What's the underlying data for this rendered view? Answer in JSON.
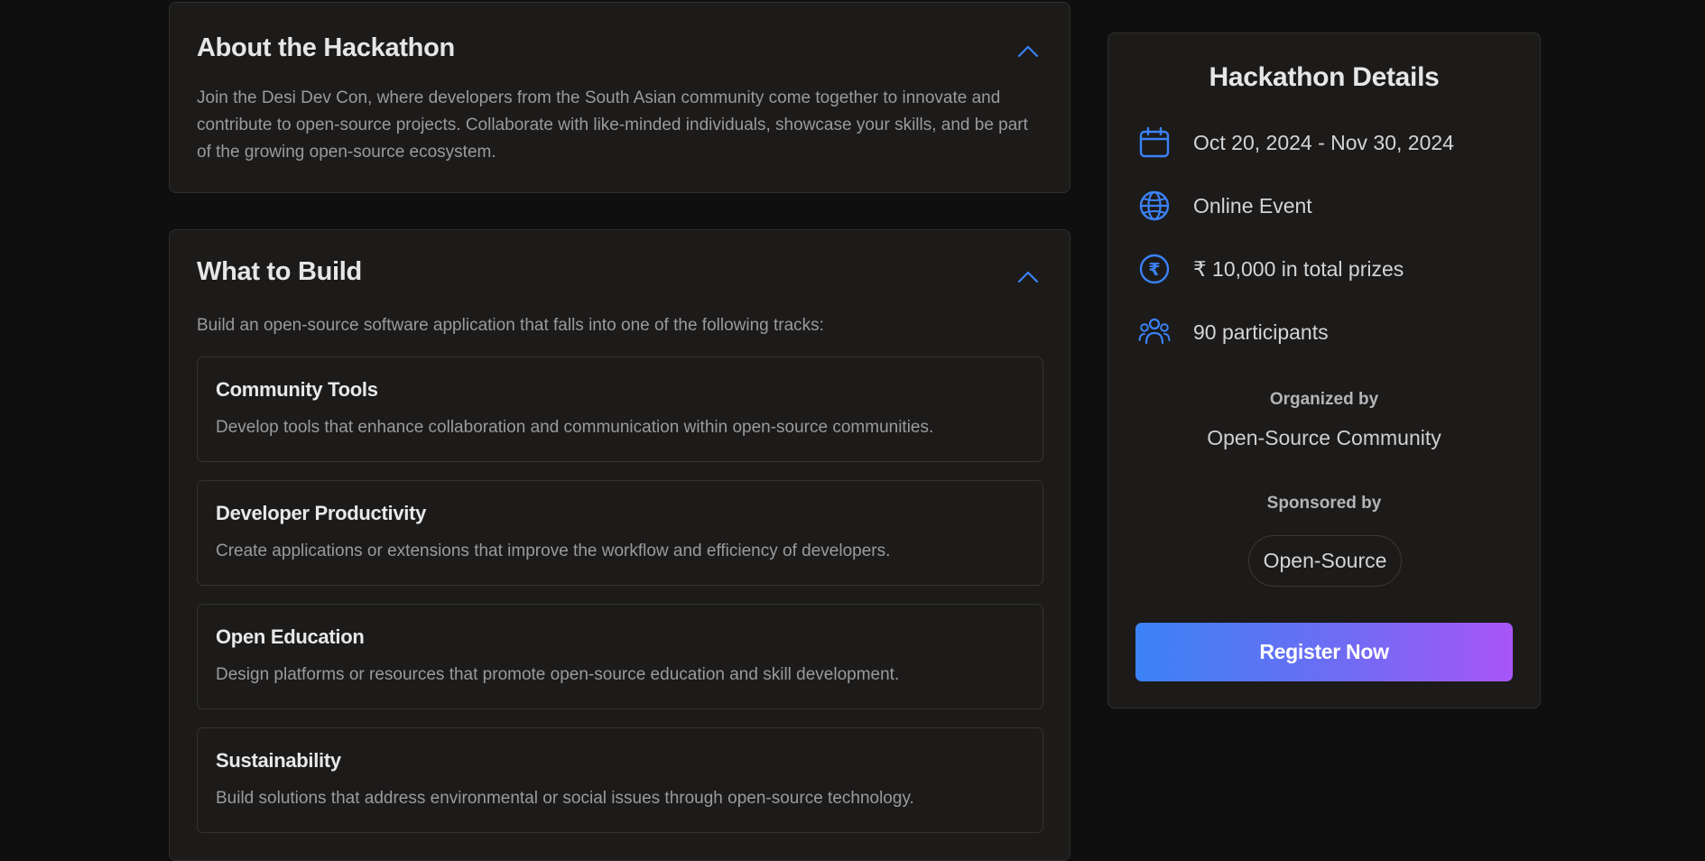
{
  "about": {
    "title": "About the Hackathon",
    "body": "Join the Desi Dev Con, where developers from the South Asian community come together to innovate and contribute to open-source projects. Collaborate with like-minded individuals, showcase your skills, and be part of the growing open-source ecosystem."
  },
  "build": {
    "title": "What to Build",
    "intro": "Build an open-source software application that falls into one of the following tracks:",
    "tracks": [
      {
        "title": "Community Tools",
        "description": "Develop tools that enhance collaboration and communication within open-source communities."
      },
      {
        "title": "Developer Productivity",
        "description": "Create applications or extensions that improve the workflow and efficiency of developers."
      },
      {
        "title": "Open Education",
        "description": "Design platforms or resources that promote open-source education and skill development."
      },
      {
        "title": "Sustainability",
        "description": "Build solutions that address environmental or social issues through open-source technology."
      }
    ]
  },
  "details": {
    "title": "Hackathon Details",
    "dates": "Oct 20, 2024 - Nov 30, 2024",
    "location": "Online Event",
    "prizes": "₹ 10,000 in total prizes",
    "participants": "90 participants",
    "organized_label": "Organized by",
    "organizer": "Open-Source Community",
    "sponsored_label": "Sponsored by",
    "sponsor": "Open-Source",
    "register_label": "Register Now"
  },
  "icons": {
    "calendar": "calendar-icon",
    "globe": "globe-icon",
    "currency": "rupee-icon",
    "participants": "users-icon",
    "collapse": "chevron-up-icon"
  },
  "colors": {
    "accent_blue": "#3b82f6",
    "accent_purple": "#a855f7",
    "background": "#0f0f10",
    "card": "#1c1b1a"
  }
}
